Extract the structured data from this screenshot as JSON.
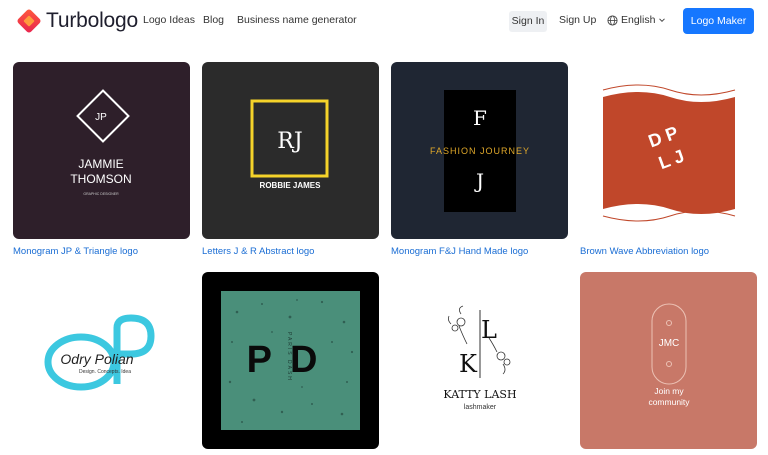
{
  "header": {
    "brand": "Turbologo",
    "nav": [
      "Logo Ideas",
      "Blog",
      "Business name generator"
    ],
    "sign_in": "Sign In",
    "sign_up": "Sign Up",
    "language": "English",
    "cta": "Logo Maker"
  },
  "cards": [
    {
      "caption": "Monogram JP & Triangle logo",
      "bg": "#2e1f2a",
      "initials": "JP",
      "name_line1": "JAMMIE",
      "name_line2": "THOMSON",
      "tagline": "GRAPHIC DESIGNER"
    },
    {
      "caption": "Letters J & R Abstract logo",
      "bg": "#2b2b2b",
      "initials": "RJ",
      "name": "ROBBIE JAMES",
      "accent": "#f5d32a"
    },
    {
      "caption": "Monogram F&J Hand Made logo",
      "bg": "#1f2633",
      "top_letter": "F",
      "bottom_letter": "J",
      "text": "FASHION JOURNEY",
      "accent": "#e0a82a"
    },
    {
      "caption": "Brown Wave Abbreviation logo",
      "bg": "#ffffff",
      "letters": "DPLJ",
      "accent": "#c0472a"
    },
    {
      "name": "Odry Polian",
      "tagline": "Design. Concepts. Idea",
      "accent": "#3cc8e0"
    },
    {
      "initials": "PD",
      "vertical_text": "PARIS DASH",
      "bg": "#4a8f7a"
    },
    {
      "letters": "LK",
      "name": "KATTY LASH",
      "tagline": "lashmaker"
    },
    {
      "initials": "JMC",
      "line1": "Join my",
      "line2": "community",
      "bg": "#c87868"
    }
  ]
}
